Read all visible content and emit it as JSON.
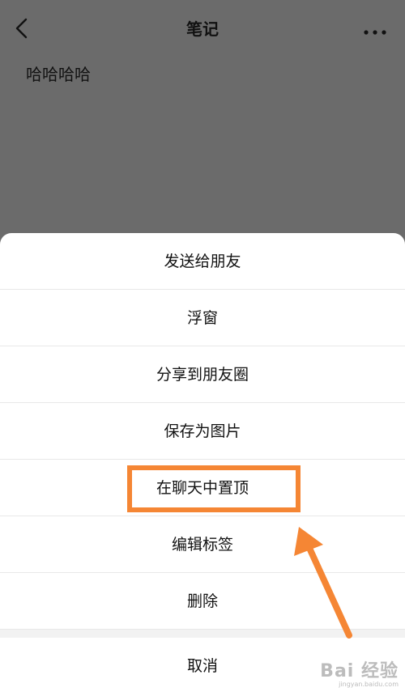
{
  "navbar": {
    "back_icon": "chevron-left-icon",
    "title": "笔记",
    "more_icon": "ellipsis-icon"
  },
  "note": {
    "content": "哈哈哈哈"
  },
  "action_sheet": {
    "items": [
      {
        "label": "发送给朋友"
      },
      {
        "label": "浮窗"
      },
      {
        "label": "分享到朋友圈"
      },
      {
        "label": "保存为图片"
      },
      {
        "label": "在聊天中置顶"
      },
      {
        "label": "编辑标签"
      },
      {
        "label": "删除"
      }
    ],
    "cancel_label": "取消"
  },
  "annotation": {
    "highlight_target": "在聊天中置顶",
    "color": "#f58634"
  },
  "watermark": {
    "main": "Bai 经验",
    "sub": "jingyan.baidu.com"
  },
  "colors": {
    "overlay": "#6b6b6b",
    "sheet": "#ffffff",
    "accent": "#f58634"
  }
}
